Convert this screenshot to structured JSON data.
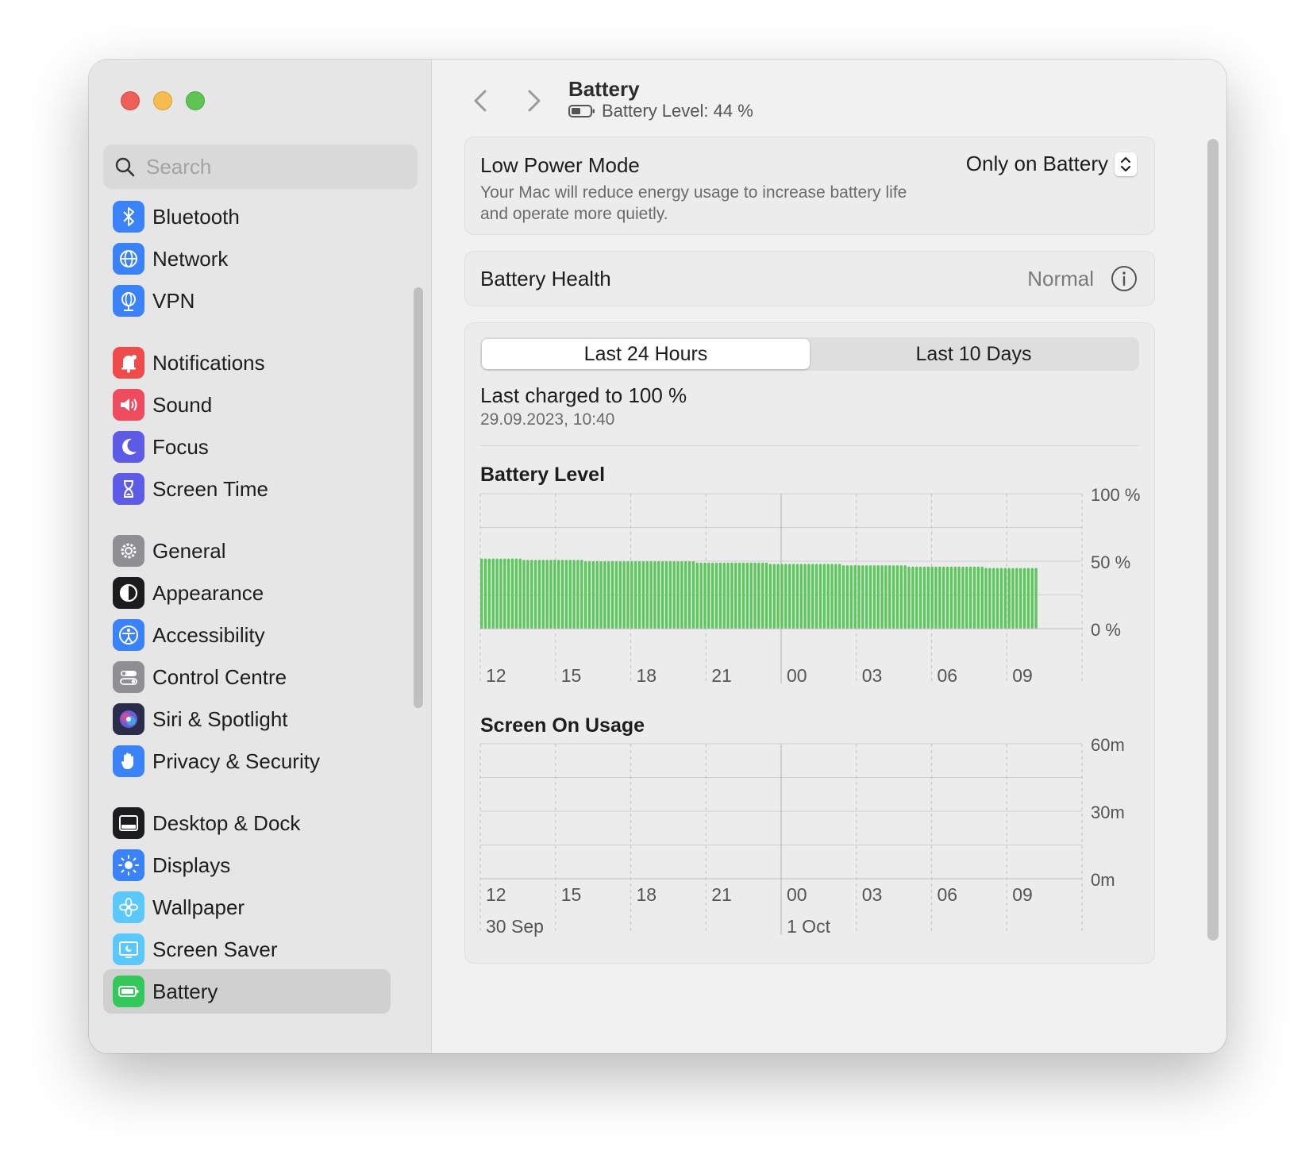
{
  "window": {
    "title": "Battery",
    "subtitle": "Battery Level: 44 %"
  },
  "sidebar": {
    "search_placeholder": "Search",
    "items": [
      {
        "label": "Bluetooth",
        "icon": "bluetooth-icon",
        "color": "#3a82f7"
      },
      {
        "label": "Network",
        "icon": "network-icon",
        "color": "#3a82f7"
      },
      {
        "label": "VPN",
        "icon": "vpn-icon",
        "color": "#3a82f7"
      },
      {
        "label": "Notifications",
        "icon": "notifications-icon",
        "color": "#ef4b4b"
      },
      {
        "label": "Sound",
        "icon": "sound-icon",
        "color": "#ef4b5f"
      },
      {
        "label": "Focus",
        "icon": "focus-icon",
        "color": "#5e5ce6"
      },
      {
        "label": "Screen Time",
        "icon": "screen-time-icon",
        "color": "#5e5ce6"
      },
      {
        "label": "General",
        "icon": "general-icon",
        "color": "#8e8e93"
      },
      {
        "label": "Appearance",
        "icon": "appearance-icon",
        "color": "#1c1c1e"
      },
      {
        "label": "Accessibility",
        "icon": "accessibility-icon",
        "color": "#3a82f7"
      },
      {
        "label": "Control Centre",
        "icon": "control-centre-icon",
        "color": "#8e8e93"
      },
      {
        "label": "Siri & Spotlight",
        "icon": "siri-icon",
        "color": "#2b2b4a"
      },
      {
        "label": "Privacy & Security",
        "icon": "privacy-hand-icon",
        "color": "#3a82f7"
      },
      {
        "label": "Desktop & Dock",
        "icon": "desktop-dock-icon",
        "color": "#1c1c1e"
      },
      {
        "label": "Displays",
        "icon": "displays-icon",
        "color": "#3a82f7"
      },
      {
        "label": "Wallpaper",
        "icon": "wallpaper-icon",
        "color": "#5ac8fa"
      },
      {
        "label": "Screen Saver",
        "icon": "screen-saver-icon",
        "color": "#5ac8fa"
      },
      {
        "label": "Battery",
        "icon": "battery-icon",
        "color": "#34c759",
        "selected": true
      }
    ]
  },
  "low_power": {
    "title": "Low Power Mode",
    "description": "Your Mac will reduce energy usage to increase battery life and operate more quietly.",
    "value": "Only on Battery"
  },
  "health": {
    "label": "Battery Health",
    "value": "Normal"
  },
  "tabs": [
    "Last 24 Hours",
    "Last 10 Days"
  ],
  "active_tab": "Last 24 Hours",
  "last_charged": {
    "text": "Last charged to 100 %",
    "date": "29.09.2023, 10:40"
  },
  "chart_data": [
    {
      "type": "bar",
      "title": "Battery Level",
      "x_ticks": [
        "12",
        "15",
        "18",
        "21",
        "00",
        "03",
        "06",
        "09"
      ],
      "y_ticks": [
        "100 %",
        "50 %",
        "0 %"
      ],
      "ylim": [
        0,
        100
      ],
      "bar_color": "#5ac85a",
      "values": [
        52,
        52,
        52,
        52,
        52,
        52,
        52,
        52,
        52,
        52,
        52,
        51,
        51,
        51,
        51,
        51,
        51,
        51,
        51,
        51,
        51,
        51,
        51,
        51,
        51,
        51,
        51,
        50,
        50,
        50,
        50,
        50,
        50,
        50,
        50,
        50,
        50,
        50,
        50,
        50,
        50,
        50,
        50,
        50,
        50,
        50,
        50,
        50,
        50,
        50,
        50,
        50,
        50,
        50,
        50,
        50,
        49,
        49,
        49,
        49,
        49,
        49,
        49,
        49,
        49,
        49,
        49,
        49,
        49,
        49,
        49,
        49,
        49,
        49,
        49,
        48,
        48,
        48,
        48,
        48,
        48,
        48,
        48,
        48,
        48,
        48,
        48,
        48,
        48,
        48,
        48,
        48,
        48,
        48,
        47,
        47,
        47,
        47,
        47,
        47,
        47,
        47,
        47,
        47,
        47,
        47,
        47,
        47,
        47,
        47,
        47,
        46,
        46,
        46,
        46,
        46,
        46,
        46,
        46,
        46,
        46,
        46,
        46,
        46,
        46,
        46,
        46,
        46,
        46,
        46,
        46,
        45,
        45,
        45,
        45,
        45,
        45,
        45,
        45,
        45,
        45,
        45,
        45,
        45,
        45
      ]
    },
    {
      "type": "bar",
      "title": "Screen On Usage",
      "x_ticks": [
        "12",
        "15",
        "18",
        "21",
        "00",
        "03",
        "06",
        "09"
      ],
      "day_labels": [
        "30 Sep",
        "1 Oct"
      ],
      "y_ticks": [
        "60m",
        "30m",
        "0m"
      ],
      "ylim": [
        0,
        60
      ],
      "values": []
    }
  ]
}
